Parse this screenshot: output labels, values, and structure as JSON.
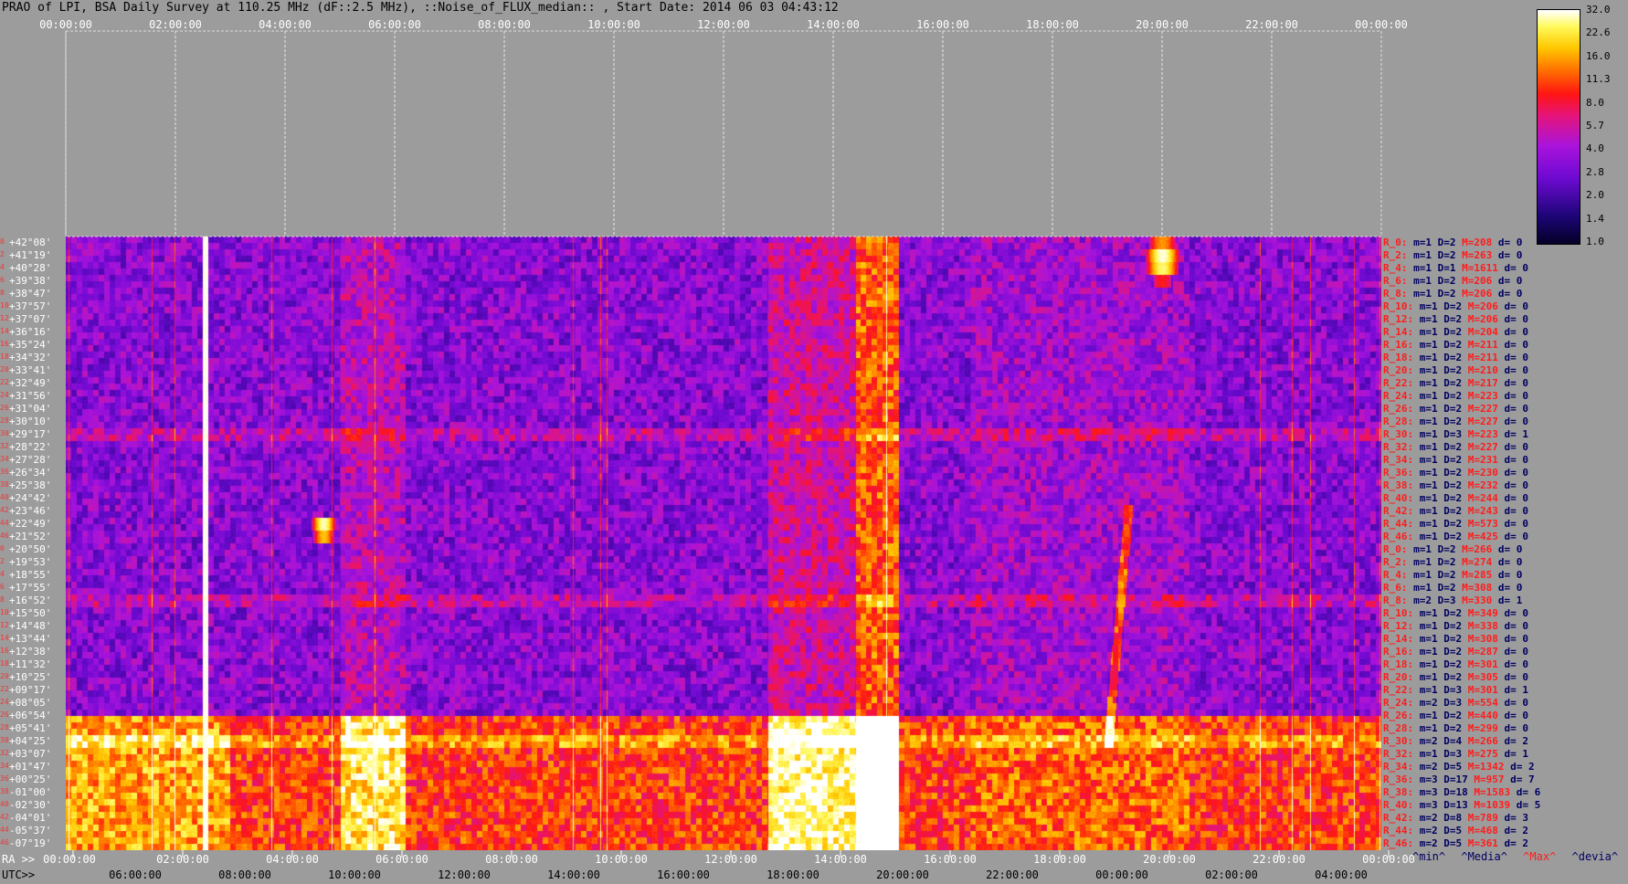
{
  "header": {
    "title": "PRAO of LPI, BSA Daily Survey at 110.25 MHz (dF::2.5 MHz), ::Noise_of_FLUX_median:: , Start Date: 2014 06 03 04:43:12"
  },
  "axes": {
    "top_ticks": [
      "00:00:00",
      "02:00:00",
      "04:00:00",
      "06:00:00",
      "08:00:00",
      "10:00:00",
      "12:00:00",
      "14:00:00",
      "16:00:00",
      "18:00:00",
      "20:00:00",
      "22:00:00",
      "00:00:00"
    ],
    "ra_label": "RA >>",
    "ra_ticks": [
      "00:00:00",
      "02:00:00",
      "04:00:00",
      "06:00:00",
      "08:00:00",
      "10:00:00",
      "12:00:00",
      "14:00:00",
      "16:00:00",
      "18:00:00",
      "20:00:00",
      "22:00:00",
      "00:00:00"
    ],
    "utc_label": "UTC>>",
    "utc_ticks": [
      "06:00:00",
      "08:00:00",
      "10:00:00",
      "12:00:00",
      "14:00:00",
      "16:00:00",
      "18:00:00",
      "20:00:00",
      "22:00:00",
      "00:00:00",
      "02:00:00",
      "04:00:00"
    ]
  },
  "rows": [
    {
      "n": "0",
      "dec": "+42°08'",
      "rl": "R_0:",
      "m": "m=1",
      "d": "D=2",
      "M": "M=208",
      "dd": "d= 0"
    },
    {
      "n": "2",
      "dec": "+41°19'",
      "rl": "R_2:",
      "m": "m=1",
      "d": "D=2",
      "M": "M=263",
      "dd": "d= 0"
    },
    {
      "n": "4",
      "dec": "+40°28'",
      "rl": "R_4:",
      "m": "m=1",
      "d": "D=1",
      "M": "M=1611",
      "dd": "d= 0"
    },
    {
      "n": "6",
      "dec": "+39°38'",
      "rl": "R_6:",
      "m": "m=1",
      "d": "D=2",
      "M": "M=206",
      "dd": "d= 0"
    },
    {
      "n": "8",
      "dec": "+38°47'",
      "rl": "R_8:",
      "m": "m=1",
      "d": "D=2",
      "M": "M=206",
      "dd": "d= 0"
    },
    {
      "n": "10",
      "dec": "+37°57'",
      "rl": "R_10:",
      "m": "m=1",
      "d": "D=2",
      "M": "M=206",
      "dd": "d= 0"
    },
    {
      "n": "12",
      "dec": "+37°07'",
      "rl": "R_12:",
      "m": "m=1",
      "d": "D=2",
      "M": "M=206",
      "dd": "d= 0"
    },
    {
      "n": "14",
      "dec": "+36°16'",
      "rl": "R_14:",
      "m": "m=1",
      "d": "D=2",
      "M": "M=204",
      "dd": "d= 0"
    },
    {
      "n": "16",
      "dec": "+35°24'",
      "rl": "R_16:",
      "m": "m=1",
      "d": "D=2",
      "M": "M=211",
      "dd": "d= 0"
    },
    {
      "n": "18",
      "dec": "+34°32'",
      "rl": "R_18:",
      "m": "m=1",
      "d": "D=2",
      "M": "M=211",
      "dd": "d= 0"
    },
    {
      "n": "20",
      "dec": "+33°41'",
      "rl": "R_20:",
      "m": "m=1",
      "d": "D=2",
      "M": "M=210",
      "dd": "d= 0"
    },
    {
      "n": "22",
      "dec": "+32°49'",
      "rl": "R_22:",
      "m": "m=1",
      "d": "D=2",
      "M": "M=217",
      "dd": "d= 0"
    },
    {
      "n": "24",
      "dec": "+31°56'",
      "rl": "R_24:",
      "m": "m=1",
      "d": "D=2",
      "M": "M=223",
      "dd": "d= 0"
    },
    {
      "n": "26",
      "dec": "+31°04'",
      "rl": "R_26:",
      "m": "m=1",
      "d": "D=2",
      "M": "M=227",
      "dd": "d= 0"
    },
    {
      "n": "28",
      "dec": "+30°10'",
      "rl": "R_28:",
      "m": "m=1",
      "d": "D=2",
      "M": "M=227",
      "dd": "d= 0"
    },
    {
      "n": "30",
      "dec": "+29°17'",
      "rl": "R_30:",
      "m": "m=1",
      "d": "D=3",
      "M": "M=223",
      "dd": "d= 1"
    },
    {
      "n": "32",
      "dec": "+28°22'",
      "rl": "R_32:",
      "m": "m=1",
      "d": "D=2",
      "M": "M=227",
      "dd": "d= 0"
    },
    {
      "n": "34",
      "dec": "+27°28'",
      "rl": "R_34:",
      "m": "m=1",
      "d": "D=2",
      "M": "M=231",
      "dd": "d= 0"
    },
    {
      "n": "36",
      "dec": "+26°34'",
      "rl": "R_36:",
      "m": "m=1",
      "d": "D=2",
      "M": "M=230",
      "dd": "d= 0"
    },
    {
      "n": "38",
      "dec": "+25°38'",
      "rl": "R_38:",
      "m": "m=1",
      "d": "D=2",
      "M": "M=232",
      "dd": "d= 0"
    },
    {
      "n": "40",
      "dec": "+24°42'",
      "rl": "R_40:",
      "m": "m=1",
      "d": "D=2",
      "M": "M=244",
      "dd": "d= 0"
    },
    {
      "n": "42",
      "dec": "+23°46'",
      "rl": "R_42:",
      "m": "m=1",
      "d": "D=2",
      "M": "M=243",
      "dd": "d= 0"
    },
    {
      "n": "44",
      "dec": "+22°49'",
      "rl": "R_44:",
      "m": "m=1",
      "d": "D=2",
      "M": "M=573",
      "dd": "d= 0"
    },
    {
      "n": "46",
      "dec": "+21°52'",
      "rl": "R_46:",
      "m": "m=1",
      "d": "D=2",
      "M": "M=425",
      "dd": "d= 0"
    },
    {
      "n": "0",
      "dec": "+20°50'",
      "rl": "R_0:",
      "m": "m=1",
      "d": "D=2",
      "M": "M=266",
      "dd": "d= 0"
    },
    {
      "n": "2",
      "dec": "+19°53'",
      "rl": "R_2:",
      "m": "m=1",
      "d": "D=2",
      "M": "M=274",
      "dd": "d= 0"
    },
    {
      "n": "4",
      "dec": "+18°55'",
      "rl": "R_4:",
      "m": "m=1",
      "d": "D=2",
      "M": "M=285",
      "dd": "d= 0"
    },
    {
      "n": "6",
      "dec": "+17°55'",
      "rl": "R_6:",
      "m": "m=1",
      "d": "D=2",
      "M": "M=308",
      "dd": "d= 0"
    },
    {
      "n": "8",
      "dec": "+16°52'",
      "rl": "R_8:",
      "m": "m=2",
      "d": "D=3",
      "M": "M=330",
      "dd": "d= 1"
    },
    {
      "n": "10",
      "dec": "+15°50'",
      "rl": "R_10:",
      "m": "m=1",
      "d": "D=2",
      "M": "M=349",
      "dd": "d= 0"
    },
    {
      "n": "12",
      "dec": "+14°48'",
      "rl": "R_12:",
      "m": "m=1",
      "d": "D=2",
      "M": "M=338",
      "dd": "d= 0"
    },
    {
      "n": "14",
      "dec": "+13°44'",
      "rl": "R_14:",
      "m": "m=1",
      "d": "D=2",
      "M": "M=308",
      "dd": "d= 0"
    },
    {
      "n": "16",
      "dec": "+12°38'",
      "rl": "R_16:",
      "m": "m=1",
      "d": "D=2",
      "M": "M=287",
      "dd": "d= 0"
    },
    {
      "n": "18",
      "dec": "+11°32'",
      "rl": "R_18:",
      "m": "m=1",
      "d": "D=2",
      "M": "M=301",
      "dd": "d= 0"
    },
    {
      "n": "20",
      "dec": "+10°25'",
      "rl": "R_20:",
      "m": "m=1",
      "d": "D=2",
      "M": "M=305",
      "dd": "d= 0"
    },
    {
      "n": "22",
      "dec": "+09°17'",
      "rl": "R_22:",
      "m": "m=1",
      "d": "D=3",
      "M": "M=301",
      "dd": "d= 1"
    },
    {
      "n": "24",
      "dec": "+08°05'",
      "rl": "R_24:",
      "m": "m=2",
      "d": "D=3",
      "M": "M=554",
      "dd": "d= 0"
    },
    {
      "n": "26",
      "dec": "+06°54'",
      "rl": "R_26:",
      "m": "m=1",
      "d": "D=2",
      "M": "M=440",
      "dd": "d= 0"
    },
    {
      "n": "28",
      "dec": "+05°41'",
      "rl": "R_28:",
      "m": "m=1",
      "d": "D=2",
      "M": "M=299",
      "dd": "d= 0"
    },
    {
      "n": "30",
      "dec": "+04°25'",
      "rl": "R_30:",
      "m": "m=2",
      "d": "D=4",
      "M": "M=266",
      "dd": "d= 2"
    },
    {
      "n": "32",
      "dec": "+03°07'",
      "rl": "R_32:",
      "m": "m=1",
      "d": "D=3",
      "M": "M=275",
      "dd": "d= 1"
    },
    {
      "n": "34",
      "dec": "+01°47'",
      "rl": "R_34:",
      "m": "m=2",
      "d": "D=5",
      "M": "M=1342",
      "dd": "d= 2"
    },
    {
      "n": "36",
      "dec": "+00°25'",
      "rl": "R_36:",
      "m": "m=3",
      "d": "D=17",
      "M": "M=957",
      "dd": "d= 7"
    },
    {
      "n": "38",
      "dec": "-01°00'",
      "rl": "R_38:",
      "m": "m=3",
      "d": "D=18",
      "M": "M=1583",
      "dd": "d= 6"
    },
    {
      "n": "40",
      "dec": "-02°30'",
      "rl": "R_40:",
      "m": "m=3",
      "d": "D=13",
      "M": "M=1039",
      "dd": "d= 5"
    },
    {
      "n": "42",
      "dec": "-04°01'",
      "rl": "R_42:",
      "m": "m=2",
      "d": "D=8",
      "M": "M=789",
      "dd": "d= 3"
    },
    {
      "n": "44",
      "dec": "-05°37'",
      "rl": "R_44:",
      "m": "m=2",
      "d": "D=5",
      "M": "M=468",
      "dd": "d= 2"
    },
    {
      "n": "46",
      "dec": "-07°19'",
      "rl": "R_46:",
      "m": "m=2",
      "d": "D=5",
      "M": "M=361",
      "dd": "d= 2"
    }
  ],
  "colorbar": {
    "labels": [
      "32.0",
      "22.6",
      "16.0",
      "11.3",
      "8.0",
      "5.7",
      "4.0",
      "2.8",
      "2.0",
      "1.4",
      "1.0"
    ]
  },
  "legend": {
    "min": "^min^",
    "media": "^Media^",
    "max": "^Max^",
    "devia": "^devia^"
  },
  "colors": {
    "background": "#9c9c9c",
    "stat_red": "#ff1c1c",
    "stat_blue": "#000060"
  },
  "chart_data": {
    "type": "heatmap",
    "title": "PRAO of LPI, BSA Daily Survey at 110.25 MHz (dF::2.5 MHz), ::Noise_of_FLUX_median:: , Start Date: 2014 06 03 04:43:12",
    "xlabel": "RA >>",
    "x2label": "UTC>>",
    "x_range": [
      "00:00:00",
      "00:00:00"
    ],
    "y_range": [
      "+42°08'",
      "-07°19'"
    ],
    "colorscale_range": [
      1.0,
      32.0
    ],
    "features": [
      {
        "ra_hours": 2.5,
        "dec_rows": "all",
        "kind": "vertical-line",
        "level": 32.0
      },
      {
        "ra_hours": 14.8,
        "dec_rows": "all",
        "kind": "band",
        "level": 11.3
      },
      {
        "ra_hours": 20.0,
        "dec_row": 1,
        "kind": "source",
        "level": 32.0
      },
      {
        "ra_hours": 4.7,
        "dec_row": 22,
        "kind": "source",
        "level": 32.0
      },
      {
        "dec_rows": [
          36,
          47
        ],
        "kind": "bright-band",
        "level": 22.6
      }
    ]
  }
}
